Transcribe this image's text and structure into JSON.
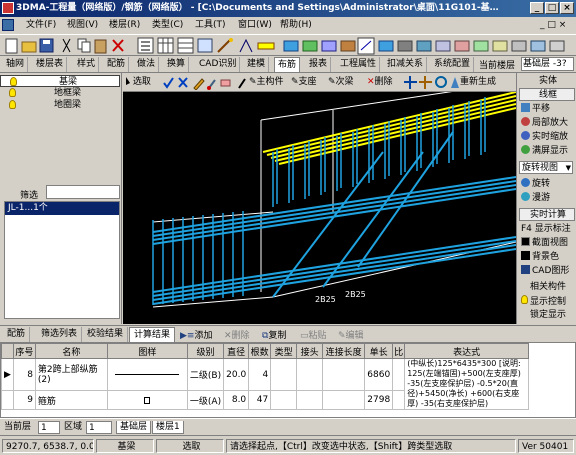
{
  "title_bar": {
    "title": "3DMA-工程量（网络版）/钢筋（网络版） - [C:\\Documents and Settings\\Administrator\\桌面\\11G101-基…"
  },
  "window_buttons": [
    "_",
    "□",
    "×"
  ],
  "menu": [
    "文件(F)",
    "视图(V)",
    "楼层(R)",
    "类型(C)",
    "工具(T)",
    "窗口(W)",
    "帮助(H)"
  ],
  "tabs": {
    "items": [
      "轴网",
      "楼层表",
      "样式",
      "配筋",
      "做法",
      "换算",
      "CAD识别",
      "建模",
      "布筋",
      "报表",
      "工程属性",
      "扣减关系",
      "系统配置"
    ],
    "active": "布筋",
    "current_floor_label": "当前楼层",
    "current_floor_value": "基础层 -3?"
  },
  "left_tree": {
    "items": [
      "基梁",
      "地框梁",
      "地圈梁"
    ],
    "filter_label": "筛选",
    "filter_value": "",
    "components": [
      "JL-1...1个"
    ]
  },
  "draw_toolbar": {
    "select": "选取",
    "main_member": "主构件",
    "support": "支座",
    "sub_rebar": "次梁",
    "delete": "删除",
    "regenerate": "重新生成"
  },
  "canvas": {
    "background": "#000000",
    "rebar_yellow": "#ffff00",
    "rebar_blue": "#1fa3e0",
    "frame_white": "#ffffff",
    "labels": [
      "2B25",
      "2B25"
    ]
  },
  "right_panel": {
    "items": [
      "实体",
      "线框",
      "平移",
      "局部放大",
      "实时缩放",
      "满屏显示",
      "旋转视图",
      "旋转",
      "漫游",
      "实时计算",
      "显示标注",
      "截面视图",
      "背景色",
      "CAD图形",
      "相关构件",
      "显示控制",
      "锁定显示"
    ],
    "f4_label": "F4"
  },
  "bottom_tabs": {
    "items": [
      "配筋",
      "筛选列表",
      "校验结果",
      "计算结果"
    ],
    "active": "计算结果",
    "actions": [
      "添加",
      "删除",
      "复制",
      "粘贴",
      "编辑"
    ]
  },
  "result_table": {
    "columns": [
      "序号",
      "名称",
      "图样",
      "级别",
      "直径",
      "根数",
      "类型",
      "接头",
      "连接长度",
      "单长",
      "比"
    ],
    "expr_header": "表达式",
    "rows": [
      {
        "no": "8",
        "name": "第2跨上部纵筋(2)",
        "grade": "二级(B)",
        "diameter": "20.0",
        "count": "4",
        "type": "",
        "joint": "",
        "conn_len": "",
        "unit_len": "6860",
        "ratio": ""
      },
      {
        "no": "9",
        "name": "箍筋",
        "grade": "一级(A)",
        "diameter": "8.0",
        "count": "47",
        "type": "",
        "joint": "",
        "conn_len": "",
        "unit_len": "2798",
        "ratio": ""
      }
    ],
    "expression": "(中纵长)125*6435*300 [说明: 125(左端锚固)+500(左支座厚) -35(左支座保护层) -0.5*20(直径)+5450(净长) +600(右支座厚) -35(右支座保护层)"
  },
  "floor_bar": {
    "label": "当前层",
    "floor_value": "1",
    "region_label": "区域",
    "region_value": "1",
    "floor_tabs": [
      "基础层",
      "楼层1"
    ]
  },
  "status_bar": {
    "coords": "9270.7, 6538.7, 0.0",
    "component": "基梁",
    "mode": "选取",
    "hint": "请选择起点,【Ctrl】改变选中状态,【Shift】跨类型选取",
    "version": "Ver 50401"
  }
}
